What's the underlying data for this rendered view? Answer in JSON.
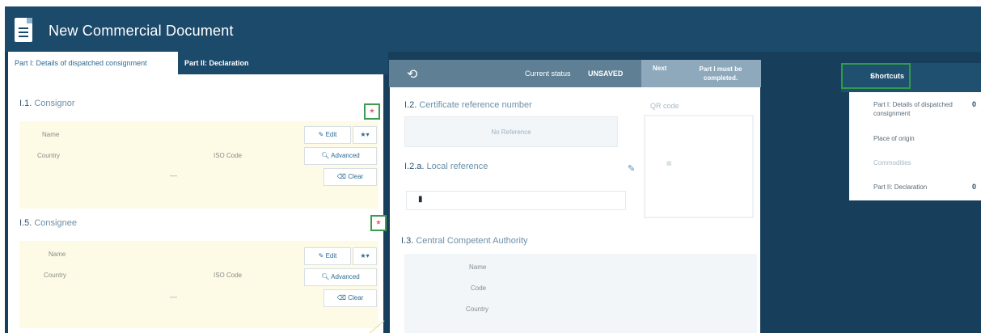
{
  "window": {
    "title": "New Commercial Document"
  },
  "tabs": [
    {
      "label": "Part I: Details of dispatched consignment"
    },
    {
      "label": "Part II: Declaration"
    }
  ],
  "toolbar": {
    "status_label": "Current status",
    "status_value": "UNSAVED",
    "hint_left": "Next",
    "hint_right": "Part I must be completed."
  },
  "consignor": {
    "number": "I.1.",
    "title": "Consignor",
    "required_mark": "*",
    "name_label": "Name",
    "country_label": "Country",
    "iso_label": "ISO Code",
    "dash": "—",
    "edit_label": "Edit",
    "advanced_label": "Advanced",
    "clear_label": "Clear"
  },
  "consignee": {
    "number": "I.5.",
    "title": "Consignee",
    "required_mark": "*",
    "name_label": "Name",
    "country_label": "Country",
    "iso_label": "ISO Code",
    "dash": "—",
    "edit_label": "Edit",
    "advanced_label": "Advanced",
    "clear_label": "Clear"
  },
  "certificate": {
    "number": "I.2.",
    "title": "Certificate reference number",
    "placeholder": "No Reference"
  },
  "qr": {
    "title": "QR code"
  },
  "local_reference": {
    "number": "I.2.a.",
    "title": "Local reference"
  },
  "authority": {
    "number": "I.3.",
    "title": "Central Competent Authority",
    "name_label": "Name",
    "code_label": "Code",
    "country_label": "Country"
  },
  "shortcuts": {
    "title": "Shortcuts",
    "items": [
      {
        "label": "Part I: Details of dispatched consignment",
        "badge": "0"
      },
      {
        "label": "Place of origin",
        "badge": ""
      },
      {
        "label": "Commodities",
        "badge": ""
      },
      {
        "label": "Part II: Declaration",
        "badge": "0"
      }
    ]
  },
  "colors": {
    "app_bg": "#173f5c",
    "title_bar": "#1c4a6b",
    "card_bg": "#fdfbe6",
    "required": "#d33a4c",
    "highlight": "#2f9a4a"
  }
}
